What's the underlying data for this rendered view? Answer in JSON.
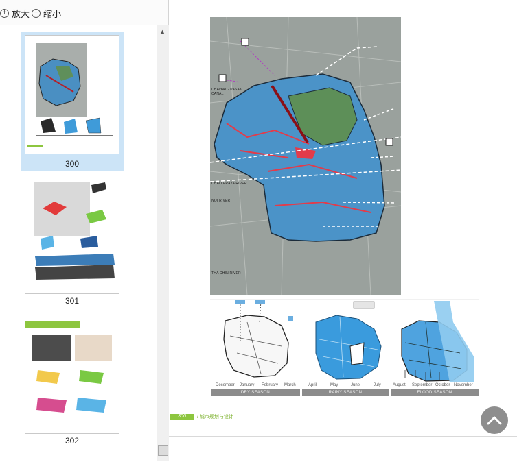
{
  "toolbar": {
    "zoom_in_label": "放大",
    "zoom_out_label": "缩小"
  },
  "thumbnails": [
    {
      "page": "300",
      "selected": true
    },
    {
      "page": "301",
      "selected": false
    },
    {
      "page": "302",
      "selected": false
    }
  ],
  "document": {
    "map_labels": {
      "chaiyat": "CHAIYAT - PASAK CANAL",
      "chao_praya": "CHAO PRAYA RIVER",
      "noi": "NOI RIVER",
      "tha_chin": "THA CHIN RIVER"
    },
    "months": {
      "dec": "December",
      "jan": "January",
      "feb": "February",
      "mar": "March",
      "apr": "April",
      "may": "May",
      "jun": "June",
      "jul": "July",
      "aug": "August",
      "sep": "September",
      "oct": "October",
      "nov": "November"
    },
    "seasons": {
      "dry": "DRY SEASON",
      "rainy": "RAINY SEASON",
      "flood": "FLOOD SEASON"
    },
    "footer": {
      "page_number": "300",
      "section": "/ 城市规划与设计"
    }
  },
  "colors": {
    "accent_green": "#8dc63f",
    "selection": "#cce4f7",
    "scroll_top_button": "#8e8e8e"
  }
}
